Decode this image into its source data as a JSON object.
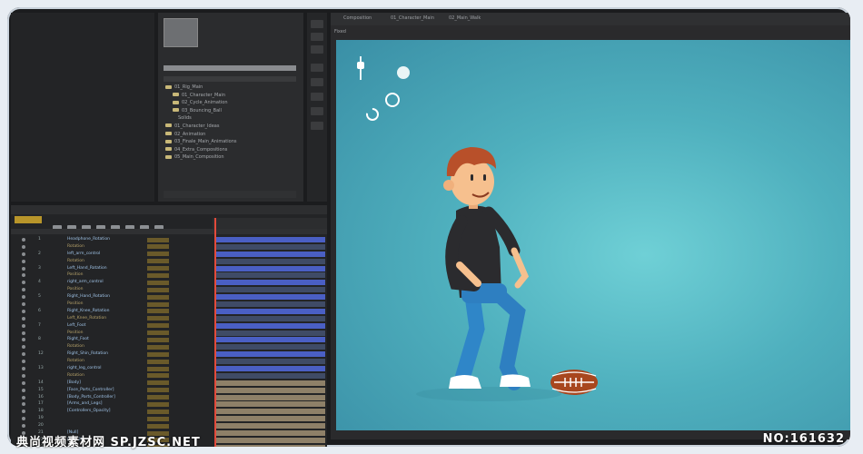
{
  "viewer": {
    "tabs": [
      "Composition",
      "01_Character_Main",
      "02_Main_Walk"
    ],
    "label": "Fixed"
  },
  "project": {
    "items": [
      "01_Rig_Main",
      "01_Character_Main",
      "02_Cycle_Animation",
      "03_Bouncing_Ball",
      "Solids",
      "01_Character_Ideas",
      "02_Animation",
      "03_Finale_Main_Animations",
      "04_Extra_Compositions",
      "05_Main_Composition"
    ]
  },
  "timeline": {
    "layers": [
      {
        "num": "1",
        "name": "Headphone_Rotation"
      },
      {
        "num": "",
        "name": "Rotation"
      },
      {
        "num": "2",
        "name": "left_arm_control"
      },
      {
        "num": "",
        "name": "Rotation"
      },
      {
        "num": "3",
        "name": "Left_Hand_Rotation"
      },
      {
        "num": "",
        "name": "Position"
      },
      {
        "num": "4",
        "name": "right_arm_control"
      },
      {
        "num": "",
        "name": "Position"
      },
      {
        "num": "5",
        "name": "Right_Hand_Rotation"
      },
      {
        "num": "",
        "name": "Position"
      },
      {
        "num": "6",
        "name": "Right_Knee_Rotation"
      },
      {
        "num": "",
        "name": "Left_Knee_Rotation"
      },
      {
        "num": "7",
        "name": "Left_Foot"
      },
      {
        "num": "",
        "name": "Position"
      },
      {
        "num": "8",
        "name": "Right_Foot"
      },
      {
        "num": "",
        "name": "Rotation"
      },
      {
        "num": "12",
        "name": "Right_Shin_Rotation"
      },
      {
        "num": "",
        "name": "Rotation"
      },
      {
        "num": "13",
        "name": "right_leg_control"
      },
      {
        "num": "",
        "name": "Rotation"
      },
      {
        "num": "14",
        "name": "[Body]"
      },
      {
        "num": "15",
        "name": "[Face_Parts_Controller]"
      },
      {
        "num": "16",
        "name": "[Body_Parts_Controller]"
      },
      {
        "num": "17",
        "name": "[Arms_and_Legs]"
      },
      {
        "num": "18",
        "name": "[Controllers_Opacity]"
      },
      {
        "num": "19",
        "name": ""
      },
      {
        "num": "20",
        "name": ""
      },
      {
        "num": "21",
        "name": "[Null]"
      },
      {
        "num": "22",
        "name": "[Null 2]"
      },
      {
        "num": "23",
        "name": ""
      }
    ]
  },
  "watermark": {
    "left": "典尚视频素材网 SP.JZSC.NET",
    "right": "NO:161632"
  },
  "colors": {
    "background": "#3a8fa6",
    "shirt": "#2b2b2e",
    "jeans": "#2e7fc1",
    "skin": "#f6c08e",
    "hair": "#b8502a",
    "playhead": "#e24a3b"
  }
}
